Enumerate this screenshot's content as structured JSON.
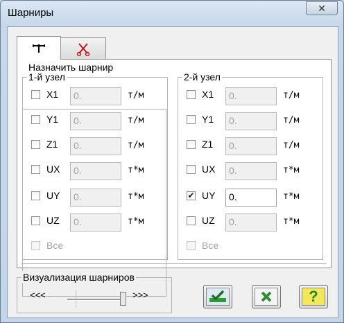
{
  "window": {
    "title": "Шарниры",
    "close_glyph": "✕"
  },
  "tabs": [
    {
      "name": "hinge-tab",
      "icon": "hinge-icon"
    },
    {
      "name": "release-tab",
      "icon": "cut-icon"
    }
  ],
  "assign_group": {
    "title": "Назначить шарнир"
  },
  "node1": {
    "title": "1-й узел",
    "rows": [
      {
        "label": "X1",
        "value": "0.",
        "unit": "т/м",
        "checked": false
      },
      {
        "label": "Y1",
        "value": "0.",
        "unit": "т/м",
        "checked": false
      },
      {
        "label": "Z1",
        "value": "0.",
        "unit": "т/м",
        "checked": false
      },
      {
        "label": "UX",
        "value": "0.",
        "unit": "т*м",
        "checked": false
      },
      {
        "label": "UY",
        "value": "0.",
        "unit": "т*м",
        "checked": false
      },
      {
        "label": "UZ",
        "value": "0.",
        "unit": "т*м",
        "checked": false
      }
    ],
    "all_label": "Все"
  },
  "node2": {
    "title": "2-й узел",
    "rows": [
      {
        "label": "X1",
        "value": "0.",
        "unit": "т/м",
        "checked": false
      },
      {
        "label": "Y1",
        "value": "0.",
        "unit": "т/м",
        "checked": false
      },
      {
        "label": "Z1",
        "value": "0.",
        "unit": "т/м",
        "checked": false
      },
      {
        "label": "UX",
        "value": "0.",
        "unit": "т*м",
        "checked": false
      },
      {
        "label": "UY",
        "value": "0.",
        "unit": "т*м",
        "checked": true
      },
      {
        "label": "UZ",
        "value": "0.",
        "unit": "т*м",
        "checked": false
      }
    ],
    "all_label": "Все"
  },
  "visualization": {
    "title": "Визуализация шарниров",
    "left_label": "<<<",
    "right_label": ">>>",
    "slider_level": 1.0
  },
  "buttons": {
    "apply_icon": "apply-check-icon",
    "cancel_icon": "cancel-x-icon",
    "help_glyph": "?"
  },
  "colors": {
    "apply_green": "#2e9b3a",
    "cancel_green": "#2e8b3a",
    "help_green": "#1c8a2b",
    "help_bg": "#f4e85a"
  }
}
